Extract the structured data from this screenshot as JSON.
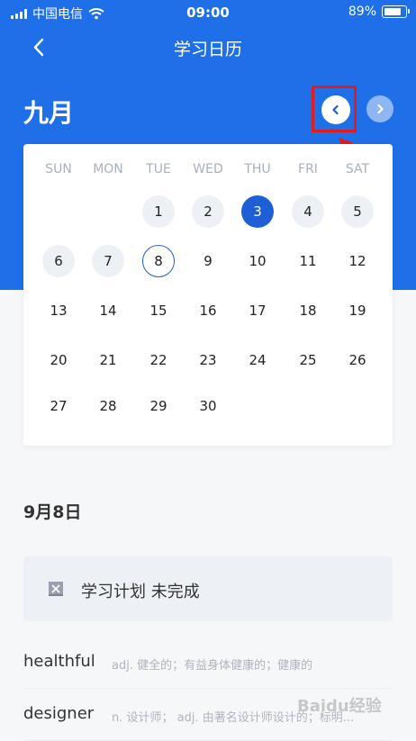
{
  "status_bar": {
    "carrier": "中国电信",
    "time": "09:00",
    "battery": "89%"
  },
  "nav": {
    "title": "学习日历"
  },
  "calendar": {
    "month": "九月",
    "weekdays": [
      "SUN",
      "MON",
      "TUE",
      "WED",
      "THU",
      "FRI",
      "SAT"
    ],
    "days": [
      {
        "n": "1",
        "col": 2,
        "row": 0,
        "state": "past"
      },
      {
        "n": "2",
        "col": 3,
        "row": 0,
        "state": "past"
      },
      {
        "n": "3",
        "col": 4,
        "row": 0,
        "state": "today"
      },
      {
        "n": "4",
        "col": 5,
        "row": 0,
        "state": "past"
      },
      {
        "n": "5",
        "col": 6,
        "row": 0,
        "state": "past"
      },
      {
        "n": "6",
        "col": 0,
        "row": 1,
        "state": "past"
      },
      {
        "n": "7",
        "col": 1,
        "row": 1,
        "state": "past"
      },
      {
        "n": "8",
        "col": 2,
        "row": 1,
        "state": "selected"
      },
      {
        "n": "9",
        "col": 3,
        "row": 1,
        "state": ""
      },
      {
        "n": "10",
        "col": 4,
        "row": 1,
        "state": ""
      },
      {
        "n": "11",
        "col": 5,
        "row": 1,
        "state": ""
      },
      {
        "n": "12",
        "col": 6,
        "row": 1,
        "state": ""
      },
      {
        "n": "13",
        "col": 0,
        "row": 2,
        "state": ""
      },
      {
        "n": "14",
        "col": 1,
        "row": 2,
        "state": ""
      },
      {
        "n": "15",
        "col": 2,
        "row": 2,
        "state": ""
      },
      {
        "n": "16",
        "col": 3,
        "row": 2,
        "state": ""
      },
      {
        "n": "17",
        "col": 4,
        "row": 2,
        "state": ""
      },
      {
        "n": "18",
        "col": 5,
        "row": 2,
        "state": ""
      },
      {
        "n": "19",
        "col": 6,
        "row": 2,
        "state": ""
      },
      {
        "n": "20",
        "col": 0,
        "row": 3,
        "state": ""
      },
      {
        "n": "21",
        "col": 1,
        "row": 3,
        "state": ""
      },
      {
        "n": "22",
        "col": 2,
        "row": 3,
        "state": ""
      },
      {
        "n": "23",
        "col": 3,
        "row": 3,
        "state": ""
      },
      {
        "n": "24",
        "col": 4,
        "row": 3,
        "state": ""
      },
      {
        "n": "25",
        "col": 5,
        "row": 3,
        "state": ""
      },
      {
        "n": "26",
        "col": 6,
        "row": 3,
        "state": ""
      },
      {
        "n": "27",
        "col": 0,
        "row": 4,
        "state": ""
      },
      {
        "n": "28",
        "col": 1,
        "row": 4,
        "state": ""
      },
      {
        "n": "29",
        "col": 2,
        "row": 4,
        "state": ""
      },
      {
        "n": "30",
        "col": 3,
        "row": 4,
        "state": ""
      }
    ]
  },
  "detail": {
    "date": "9月8日",
    "plan_text": "学习计划 未完成",
    "words": [
      {
        "word": "healthful",
        "meaning": "adj. 健全的；有益身体健康的；健康的"
      },
      {
        "word": "designer",
        "meaning": "n. 设计师；  adj. 由著名设计师设计的；标明..."
      }
    ]
  },
  "watermark": "Baidu经验",
  "colors": {
    "primary": "#1f6fe8",
    "today": "#1f5fd6",
    "highlight": "#e01c1c"
  }
}
